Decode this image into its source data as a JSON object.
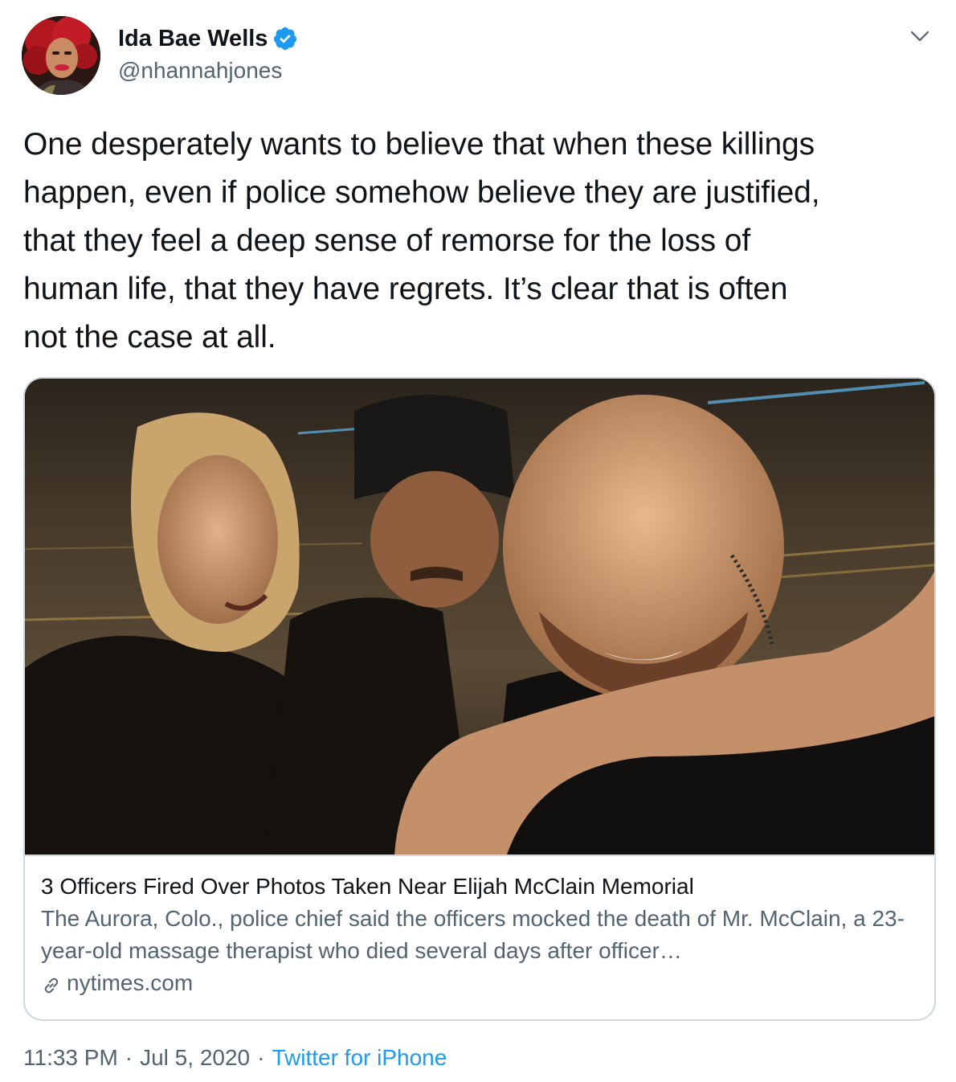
{
  "author": {
    "display_name": "Ida Bae Wells",
    "handle": "@nhannahjones",
    "verified": true
  },
  "icons": {
    "verified": "verified-badge-icon",
    "more": "chevron-down-icon",
    "link": "link-icon"
  },
  "colors": {
    "accent": "#1d9bf0",
    "text": "#0f1419",
    "secondary": "#536471",
    "border": "#cfd9de"
  },
  "tweet": {
    "text": "One desperately wants to believe that when these killings\nhappen, even if police somehow believe they are justified,\nthat they feel a deep sense of remorse for the loss of\nhuman life, that they have regrets. It’s clear that is often\nnot the case at all."
  },
  "card": {
    "title": "3 Officers Fired Over Photos Taken Near Elijah McClain Memorial",
    "description": "The Aurora, Colo., police chief said the officers mocked the death of Mr. McClain, a 23-year-old massage therapist who died several days after officer…",
    "domain": "nytimes.com"
  },
  "meta": {
    "time": "11:33 PM",
    "separator": "·",
    "date": "Jul 5, 2020",
    "source": "Twitter for iPhone"
  }
}
